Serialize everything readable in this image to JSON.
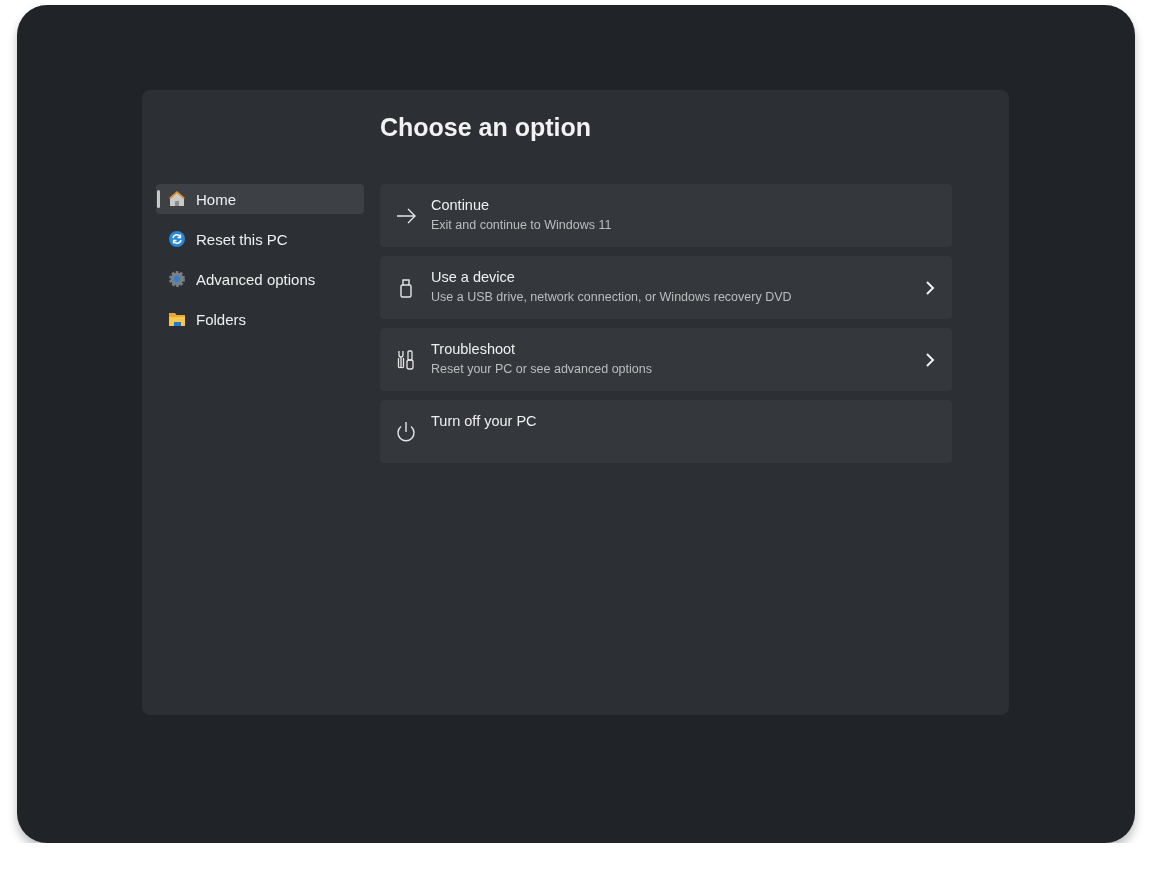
{
  "title": "Choose an option",
  "sidebar": {
    "items": [
      {
        "kind": "home",
        "label": "Home",
        "selected": true
      },
      {
        "kind": "reset",
        "label": "Reset this PC",
        "selected": false
      },
      {
        "kind": "gear",
        "label": "Advanced options",
        "selected": false
      },
      {
        "kind": "folder",
        "label": "Folders",
        "selected": false
      }
    ]
  },
  "options": [
    {
      "kind": "arrow",
      "title": "Continue",
      "description": "Exit and continue to Windows 11",
      "chevron": false
    },
    {
      "kind": "usb",
      "title": "Use a device",
      "description": "Use a USB drive, network connection, or Windows recovery DVD",
      "chevron": true
    },
    {
      "kind": "tools",
      "title": "Troubleshoot",
      "description": "Reset your PC or see advanced options",
      "chevron": true
    },
    {
      "kind": "power",
      "title": "Turn off your PC",
      "chevron": false
    }
  ]
}
